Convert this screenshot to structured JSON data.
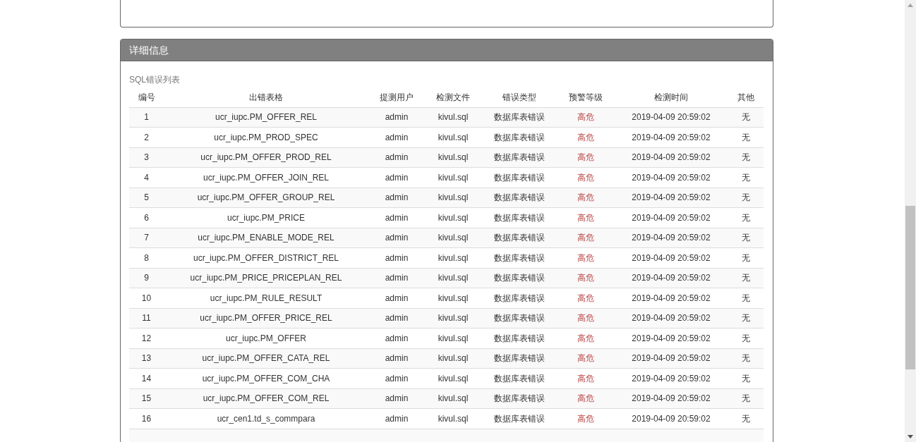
{
  "panel": {
    "title": "详细信息",
    "subtitle": "SQL错误列表"
  },
  "table": {
    "columns": [
      "编号",
      "出错表格",
      "提测用户",
      "检测文件",
      "错误类型",
      "预警等级",
      "检测时间",
      "其他"
    ],
    "rows": [
      {
        "no": "1",
        "table": "ucr_iupc.PM_OFFER_REL",
        "user": "admin",
        "file": "kivul.sql",
        "type": "数据库表错误",
        "alert": "高危",
        "kind": "danger",
        "time": "2019-04-09 20:59:02",
        "other": "无"
      },
      {
        "no": "2",
        "table": "ucr_iupc.PM_PROD_SPEC",
        "user": "admin",
        "file": "kivul.sql",
        "type": "数据库表错误",
        "alert": "高危",
        "kind": "danger",
        "time": "2019-04-09 20:59:02",
        "other": "无"
      },
      {
        "no": "3",
        "table": "ucr_iupc.PM_OFFER_PROD_REL",
        "user": "admin",
        "file": "kivul.sql",
        "type": "数据库表错误",
        "alert": "高危",
        "kind": "danger",
        "time": "2019-04-09 20:59:02",
        "other": "无"
      },
      {
        "no": "4",
        "table": "ucr_iupc.PM_OFFER_JOIN_REL",
        "user": "admin",
        "file": "kivul.sql",
        "type": "数据库表错误",
        "alert": "高危",
        "kind": "danger",
        "time": "2019-04-09 20:59:02",
        "other": "无"
      },
      {
        "no": "5",
        "table": "ucr_iupc.PM_OFFER_GROUP_REL",
        "user": "admin",
        "file": "kivul.sql",
        "type": "数据库表错误",
        "alert": "高危",
        "kind": "danger",
        "time": "2019-04-09 20:59:02",
        "other": "无"
      },
      {
        "no": "6",
        "table": "ucr_iupc.PM_PRICE",
        "user": "admin",
        "file": "kivul.sql",
        "type": "数据库表错误",
        "alert": "高危",
        "kind": "danger",
        "time": "2019-04-09 20:59:02",
        "other": "无"
      },
      {
        "no": "7",
        "table": "ucr_iupc.PM_ENABLE_MODE_REL",
        "user": "admin",
        "file": "kivul.sql",
        "type": "数据库表错误",
        "alert": "高危",
        "kind": "danger",
        "time": "2019-04-09 20:59:02",
        "other": "无"
      },
      {
        "no": "8",
        "table": "ucr_iupc.PM_OFFER_DISTRICT_REL",
        "user": "admin",
        "file": "kivul.sql",
        "type": "数据库表错误",
        "alert": "高危",
        "kind": "danger",
        "time": "2019-04-09 20:59:02",
        "other": "无"
      },
      {
        "no": "9",
        "table": "ucr_iupc.PM_PRICE_PRICEPLAN_REL",
        "user": "admin",
        "file": "kivul.sql",
        "type": "数据库表错误",
        "alert": "高危",
        "kind": "danger",
        "time": "2019-04-09 20:59:02",
        "other": "无"
      },
      {
        "no": "10",
        "table": "ucr_iupc.PM_RULE_RESULT",
        "user": "admin",
        "file": "kivul.sql",
        "type": "数据库表错误",
        "alert": "高危",
        "kind": "danger",
        "time": "2019-04-09 20:59:02",
        "other": "无"
      },
      {
        "no": "11",
        "table": "ucr_iupc.PM_OFFER_PRICE_REL",
        "user": "admin",
        "file": "kivul.sql",
        "type": "数据库表错误",
        "alert": "高危",
        "kind": "danger",
        "time": "2019-04-09 20:59:02",
        "other": "无"
      },
      {
        "no": "12",
        "table": "ucr_iupc.PM_OFFER",
        "user": "admin",
        "file": "kivul.sql",
        "type": "数据库表错误",
        "alert": "高危",
        "kind": "danger",
        "time": "2019-04-09 20:59:02",
        "other": "无"
      },
      {
        "no": "13",
        "table": "ucr_iupc.PM_OFFER_CATA_REL",
        "user": "admin",
        "file": "kivul.sql",
        "type": "数据库表错误",
        "alert": "高危",
        "kind": "danger",
        "time": "2019-04-09 20:59:02",
        "other": "无"
      },
      {
        "no": "14",
        "table": "ucr_iupc.PM_OFFER_COM_CHA",
        "user": "admin",
        "file": "kivul.sql",
        "type": "数据库表错误",
        "alert": "高危",
        "kind": "danger",
        "time": "2019-04-09 20:59:02",
        "other": "无"
      },
      {
        "no": "15",
        "table": "ucr_iupc.PM_OFFER_COM_REL",
        "user": "admin",
        "file": "kivul.sql",
        "type": "数据库表错误",
        "alert": "高危",
        "kind": "danger",
        "time": "2019-04-09 20:59:02",
        "other": "无"
      },
      {
        "no": "16",
        "table": "ucr_cen1.td_s_commpara",
        "user": "admin",
        "file": "kivul.sql",
        "type": "数据库表错误",
        "alert": "高危",
        "kind": "danger",
        "time": "2019-04-09 20:59:02",
        "other": "无"
      }
    ]
  }
}
